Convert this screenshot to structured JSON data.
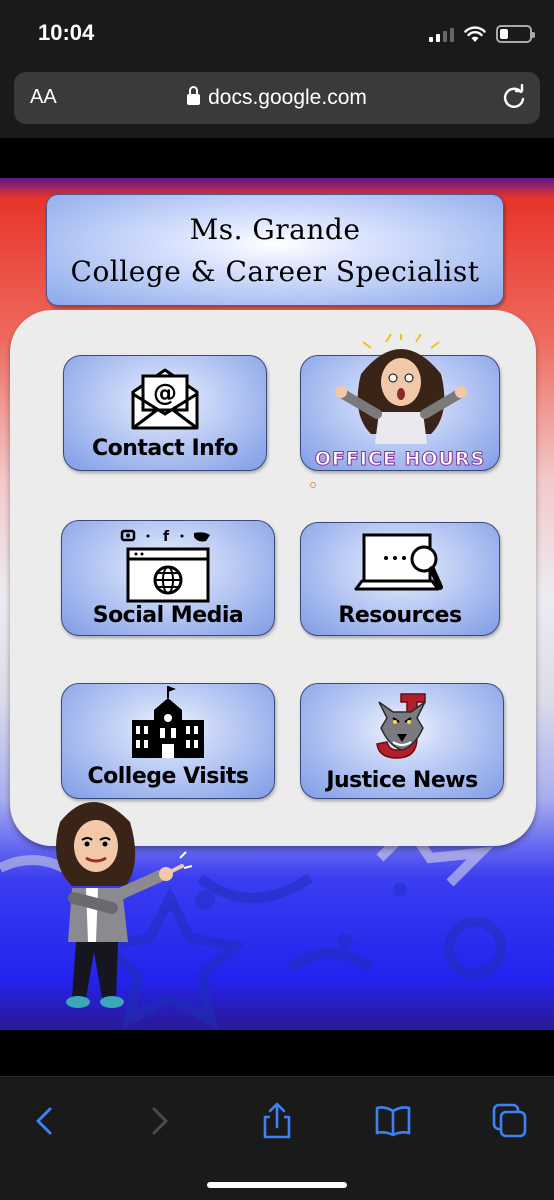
{
  "status_bar": {
    "time": "10:04"
  },
  "browser": {
    "text_size_button": "AA",
    "url": "docs.google.com"
  },
  "document": {
    "title_line1": "Ms. Grande",
    "title_line2": "College & Career Specialist",
    "tiles": [
      {
        "label": "Contact Info",
        "icon": "envelope-at-icon"
      },
      {
        "label": "OFFICE HOURS",
        "icon": "excited-avatar-icon"
      },
      {
        "label": "Social Media",
        "icon": "browser-social-icon"
      },
      {
        "label": "Resources",
        "icon": "laptop-search-icon"
      },
      {
        "label": "College Visits",
        "icon": "school-building-icon"
      },
      {
        "label": "Justice News",
        "icon": "wolf-logo-icon"
      }
    ],
    "colors": {
      "top": "#e8342a",
      "bottom": "#2323ee",
      "tile": "#7f9ce6"
    }
  },
  "toolbar": {
    "icons": [
      "back-icon",
      "forward-icon",
      "share-icon",
      "bookmarks-icon",
      "tabs-icon"
    ]
  }
}
